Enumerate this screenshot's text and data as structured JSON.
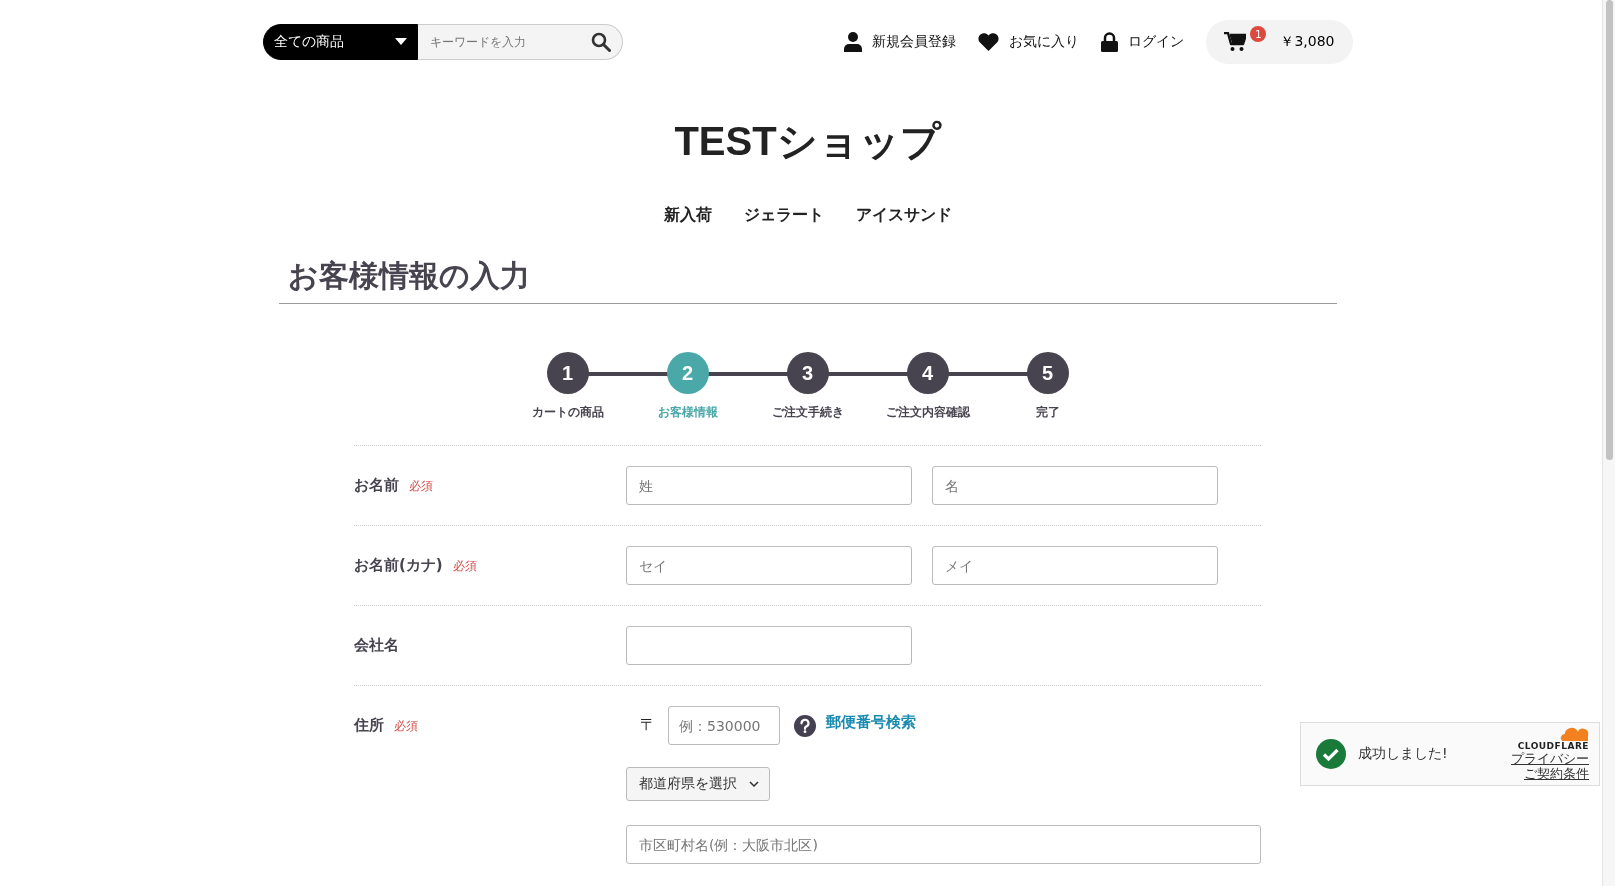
{
  "header": {
    "category_select": {
      "label": "全ての商品"
    },
    "search": {
      "placeholder": "キーワードを入力"
    },
    "links": [
      {
        "label": "新規会員登録"
      },
      {
        "label": "お気に入り"
      },
      {
        "label": "ログイン"
      }
    ],
    "cart": {
      "badge": "1",
      "total": "￥3,080"
    }
  },
  "shop_title": "TESTショップ",
  "nav": [
    {
      "label": "新入荷"
    },
    {
      "label": "ジェラート"
    },
    {
      "label": "アイスサンド"
    }
  ],
  "page_title": "お客様情報の入力",
  "steps": [
    {
      "number": "1",
      "label": "カートの商品",
      "selected": false
    },
    {
      "number": "2",
      "label": "お客様情報",
      "selected": true
    },
    {
      "number": "3",
      "label": "ご注文手続き",
      "selected": false
    },
    {
      "number": "4",
      "label": "ご注文内容確認",
      "selected": false
    },
    {
      "number": "5",
      "label": "完了",
      "selected": false
    }
  ],
  "form_rows": [
    {
      "kind": "pair",
      "label": "お名前",
      "badge": "必須",
      "fields": [
        {
          "placeholder": "姓"
        },
        {
          "placeholder": "名"
        }
      ]
    },
    {
      "kind": "pair",
      "label": "お名前(カナ)",
      "badge": "必須",
      "fields": [
        {
          "placeholder": "セイ"
        },
        {
          "placeholder": "メイ"
        }
      ]
    },
    {
      "kind": "single",
      "label": "会社名"
    },
    {
      "kind": "address",
      "label": "住所",
      "badge": "必須",
      "zip_mark": "〒",
      "zip": {
        "placeholder": "例：530000"
      },
      "zip_search_link": "郵便番号検索",
      "prefecture_select": {
        "label": "都道府県を選択"
      },
      "city": {
        "placeholder": "市区町村名(例：大阪市北区)"
      }
    }
  ],
  "captcha_widget": {
    "message": "成功しました!",
    "brand": "CLOUDFLARE",
    "links": [
      "プライバシー",
      "ご契約条件"
    ]
  }
}
